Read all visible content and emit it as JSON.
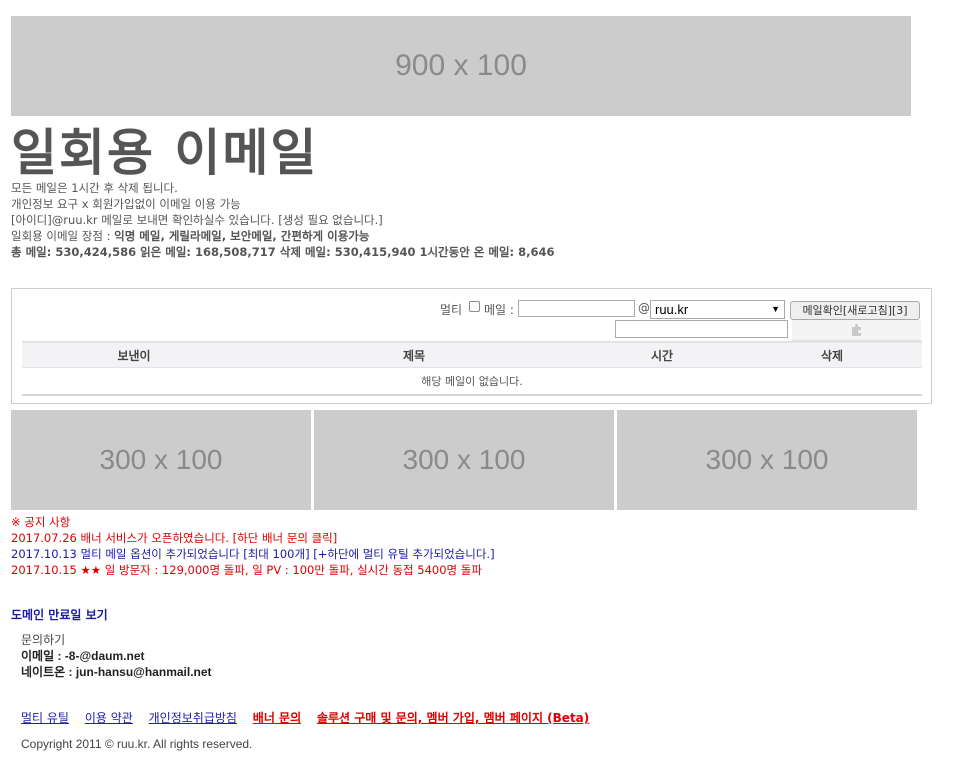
{
  "top_banner": {
    "label": "900 x 100"
  },
  "page_title": "일회용 이메일",
  "info": {
    "line1": "모든 메일은 1시간 후 삭제 됩니다.",
    "line2": "개인정보 요구 x 회원가입없이 이메일 이용 가능",
    "line3": "[아이디]@ruu.kr 메일로 보내면 확인하실수 있습니다. [생성 필요 없습니다.]",
    "line4_prefix": "일회용 이메일 장점 : ",
    "line4_bold": "익명 메일, 게릴라메일, 보안메일, 간편하게 이용가능",
    "stats": "총 메일: 530,424,586 읽은 메일: 168,508,717 삭제 메일: 530,415,940 1시간동안 온 메일: 8,646"
  },
  "mail_form": {
    "multi_label": "멀티",
    "mail_label": "메일 :",
    "mail_value": "",
    "at": "@",
    "domain_selected": "ruu.kr",
    "check_button": "메일확인[새로고침][3]",
    "captcha_value": ""
  },
  "mail_table": {
    "columns": [
      "보낸이",
      "제목",
      "시간",
      "삭제"
    ],
    "empty_text": "해당 메일이 없습니다."
  },
  "mid_banners": [
    "300 x 100",
    "300 x 100",
    "300 x 100"
  ],
  "notices": {
    "header": "※ 공지 사항",
    "items": [
      "2017.07.26 배너 서비스가 오픈하였습니다. [하단 배너 문의 클릭]",
      "2017.10.13 멀티 메일 옵션이 추가되었습니다 [최대 100개] [+하단에 멀티 유틸 추가되었습니다.]",
      "2017.10.15 ★★ 일 방문자 : 129,000명 돌파, 일 PV : 100만 돌파, 실시간 동접 5400명 돌파"
    ]
  },
  "domain_link": "도메인 만료일 보기",
  "contact": {
    "heading": "문의하기",
    "email": "이메일 : -8-@daum.net",
    "nateon": "네이트온 : jun-hansu@hanmail.net"
  },
  "footer_links": [
    "멀티 유틸",
    "이용 약관",
    "개인정보취급방침",
    "배너 문의",
    "솔루션 구매 및 문의, 멤버 가입, 멤버 페이지 (Beta)"
  ],
  "copyright": "Copyright 2011 © ruu.kr. All rights reserved.",
  "colors": {
    "notice_red": "#dd0000",
    "notice_blue": "#1a1aa6",
    "placeholder_gray": "#cccccc"
  }
}
